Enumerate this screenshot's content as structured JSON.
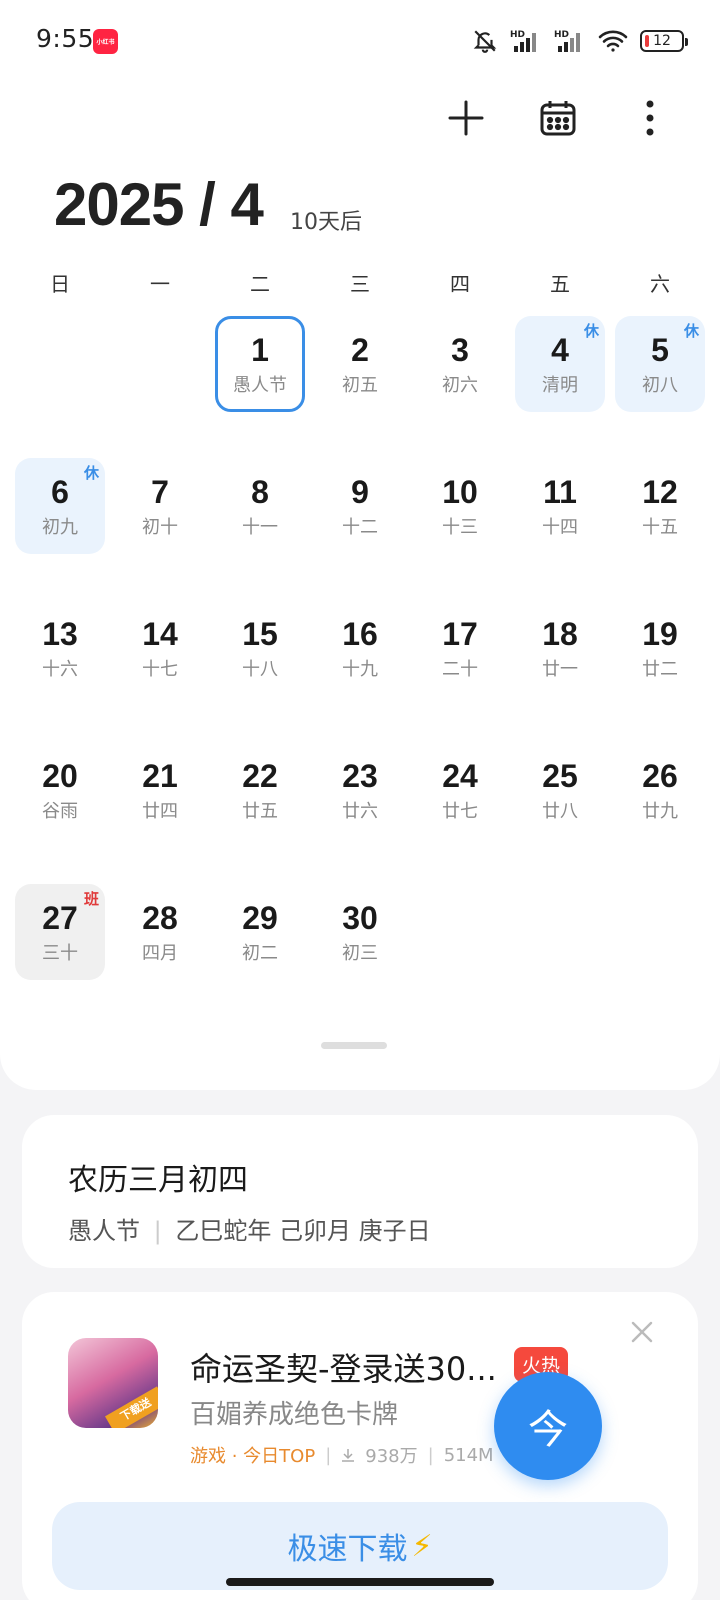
{
  "status_bar": {
    "time": "9:55",
    "app_badge": "小红书",
    "signal_1_label": "HD",
    "signal_2_label": "HD",
    "battery": "12"
  },
  "header": {
    "month_title": "2025 / 4",
    "relative": "10天后"
  },
  "weekdays": [
    "日",
    "一",
    "二",
    "三",
    "四",
    "五",
    "六"
  ],
  "days": [
    {
      "num": "1",
      "lunar": "愚人节",
      "tag": ""
    },
    {
      "num": "2",
      "lunar": "初五",
      "tag": ""
    },
    {
      "num": "3",
      "lunar": "初六",
      "tag": ""
    },
    {
      "num": "4",
      "lunar": "清明",
      "tag": "休"
    },
    {
      "num": "5",
      "lunar": "初八",
      "tag": "休"
    },
    {
      "num": "6",
      "lunar": "初九",
      "tag": "休"
    },
    {
      "num": "7",
      "lunar": "初十",
      "tag": ""
    },
    {
      "num": "8",
      "lunar": "十一",
      "tag": ""
    },
    {
      "num": "9",
      "lunar": "十二",
      "tag": ""
    },
    {
      "num": "10",
      "lunar": "十三",
      "tag": ""
    },
    {
      "num": "11",
      "lunar": "十四",
      "tag": ""
    },
    {
      "num": "12",
      "lunar": "十五",
      "tag": ""
    },
    {
      "num": "13",
      "lunar": "十六",
      "tag": ""
    },
    {
      "num": "14",
      "lunar": "十七",
      "tag": ""
    },
    {
      "num": "15",
      "lunar": "十八",
      "tag": ""
    },
    {
      "num": "16",
      "lunar": "十九",
      "tag": ""
    },
    {
      "num": "17",
      "lunar": "二十",
      "tag": ""
    },
    {
      "num": "18",
      "lunar": "廿一",
      "tag": ""
    },
    {
      "num": "19",
      "lunar": "廿二",
      "tag": ""
    },
    {
      "num": "20",
      "lunar": "谷雨",
      "tag": ""
    },
    {
      "num": "21",
      "lunar": "廿四",
      "tag": ""
    },
    {
      "num": "22",
      "lunar": "廿五",
      "tag": ""
    },
    {
      "num": "23",
      "lunar": "廿六",
      "tag": ""
    },
    {
      "num": "24",
      "lunar": "廿七",
      "tag": ""
    },
    {
      "num": "25",
      "lunar": "廿八",
      "tag": ""
    },
    {
      "num": "26",
      "lunar": "廿九",
      "tag": ""
    },
    {
      "num": "27",
      "lunar": "三十",
      "tag": "班"
    },
    {
      "num": "28",
      "lunar": "四月",
      "tag": ""
    },
    {
      "num": "29",
      "lunar": "初二",
      "tag": ""
    },
    {
      "num": "30",
      "lunar": "初三",
      "tag": ""
    }
  ],
  "info_card": {
    "title": "农历三月初四",
    "festival": "愚人节",
    "ganzhi": "乙巳蛇年 己卯月 庚子日"
  },
  "ad": {
    "title": "命运圣契-登录送30...",
    "hot_badge": "火热",
    "description": "百媚养成绝色卡牌",
    "category": "游戏 · 今日TOP",
    "downloads": "938万",
    "size": "514M",
    "icon_banner": "下载送",
    "download_label": "极速下载",
    "bolt": "⚡"
  },
  "fab": {
    "label": "今"
  },
  "colors": {
    "accent": "#3a8ee6",
    "holiday_bg": "#eaf3fd",
    "workday_tag": "#e03b3b",
    "fab": "#2f8cf0"
  }
}
